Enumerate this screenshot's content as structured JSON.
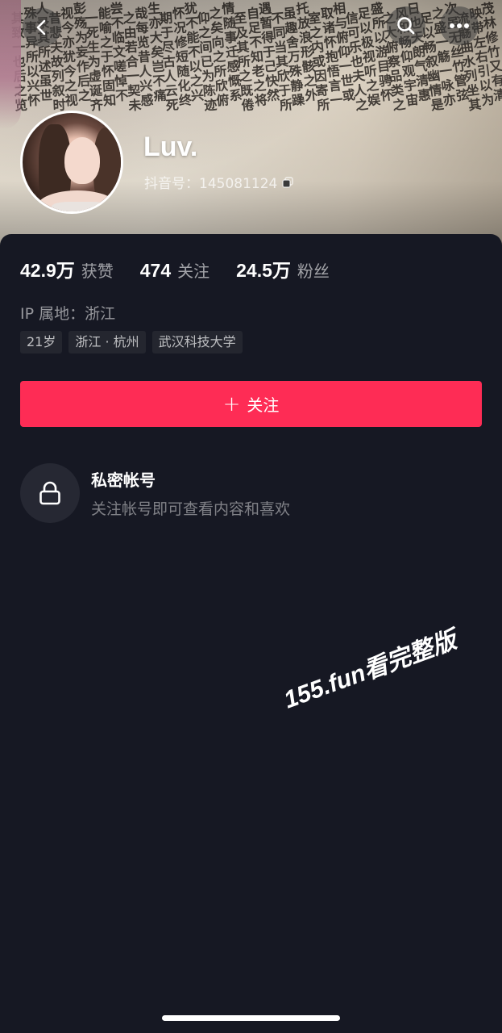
{
  "cover": {
    "calligraphy_columns": [
      "茂林修竹又有清",
      "映带左右引以为",
      "流觞曲水列坐其",
      "次虽无丝竹管弦",
      "之盛一觞一咏亦",
      "足以畅叙幽情是",
      "日也天朗气清惠",
      "风和畅仰观宇宙",
      "之大俯察品类之",
      "盛所以游目骋怀",
      "足以极视听之娱",
      "信可乐也夫人之",
      "相与俯仰一世或",
      "取诸怀抱悟言一",
      "室之内或因寄所",
      "托放浪形骸之外",
      "虽趣舍万殊静躁",
      "不同当其欣于所",
      "遇暂得于己快然",
      "自足不知老之将",
      "至及其所之既倦",
      "情随事迁感慨系",
      "之矣向之所欣俯",
      "仰之间已为陈迹",
      "犹不能不以之兴",
      "怀况修短随化终",
      "期于尽古人云死",
      "生亦大矣岂不痛",
      "哉每览昔人兴感",
      "之由若合一契未",
      "尝不临文嗟悼不",
      "能喻之于怀固知",
      "一死生为虚诞齐",
      "彭殇为妄作后之",
      "视今亦犹今之视",
      "昔悲夫故列叙时",
      "人录其所述虽世",
      "殊事异所以兴怀",
      "其致一也后之览"
    ]
  },
  "top_bar": {
    "back_icon": "chevron-left-icon",
    "search_icon": "search-icon",
    "more_icon": "more-dots-icon"
  },
  "profile": {
    "name": "Luv.",
    "douyin_id": "抖音号：145081124",
    "copy_icon": "copy-icon"
  },
  "stats": [
    {
      "value": "42.9万",
      "label": "获赞"
    },
    {
      "value": "474",
      "label": "关注"
    },
    {
      "value": "24.5万",
      "label": "粉丝"
    }
  ],
  "ip_location": "IP 属地：浙江",
  "tags": [
    "21岁",
    "浙江 · 杭州",
    "武汉科技大学"
  ],
  "follow_button": {
    "plus": "+",
    "label": "关注"
  },
  "private_account": {
    "icon": "lock-icon",
    "title": "私密帐号",
    "subtitle": "关注帐号即可查看内容和喜欢"
  },
  "watermark": "155.fun看完整版",
  "colors": {
    "background": "#161823",
    "accent": "#fe2c55",
    "tag_bg": "#24262f"
  }
}
